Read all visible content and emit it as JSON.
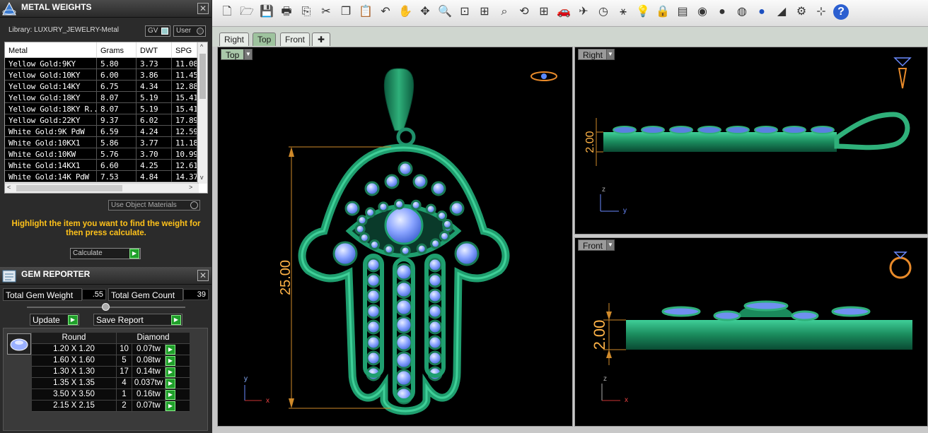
{
  "metal_panel": {
    "title": "METAL WEIGHTS",
    "library": "Library: LUXURY_JEWELRY-Metal",
    "toggle_gv": "GV",
    "toggle_user": "User",
    "columns": [
      "Metal",
      "Grams",
      "DWT",
      "SPG"
    ],
    "rows": [
      {
        "metal": "Yellow Gold:9KY",
        "grams": "5.80",
        "dwt": "3.73",
        "spg": "11.08"
      },
      {
        "metal": "Yellow Gold:10KY",
        "grams": "6.00",
        "dwt": "3.86",
        "spg": "11.45"
      },
      {
        "metal": "Yellow Gold:14KY",
        "grams": "6.75",
        "dwt": "4.34",
        "spg": "12.88"
      },
      {
        "metal": "Yellow Gold:18KY",
        "grams": "8.07",
        "dwt": "5.19",
        "spg": "15.41"
      },
      {
        "metal": "Yellow Gold:18KY R...",
        "grams": "8.07",
        "dwt": "5.19",
        "spg": "15.41"
      },
      {
        "metal": "Yellow Gold:22KY",
        "grams": "9.37",
        "dwt": "6.02",
        "spg": "17.89"
      },
      {
        "metal": "White Gold:9K PdW",
        "grams": "6.59",
        "dwt": "4.24",
        "spg": "12.59"
      },
      {
        "metal": "White Gold:10KX1",
        "grams": "5.86",
        "dwt": "3.77",
        "spg": "11.18"
      },
      {
        "metal": "White Gold:10KW",
        "grams": "5.76",
        "dwt": "3.70",
        "spg": "10.99"
      },
      {
        "metal": "White Gold:14KX1",
        "grams": "6.60",
        "dwt": "4.25",
        "spg": "12.61"
      },
      {
        "metal": "White Gold:14K PdW",
        "grams": "7.53",
        "dwt": "4.84",
        "spg": "14.37"
      }
    ],
    "use_object_materials": "Use Object Materials",
    "hint": "Highlight the item you want to find the weight for then press calculate.",
    "calculate": "Calculate"
  },
  "gem_panel": {
    "title": "GEM REPORTER",
    "total_weight_label": "Total Gem Weight",
    "total_weight_value": ".55",
    "total_count_label": "Total Gem Count",
    "total_count_value": "39",
    "update": "Update",
    "save_report": "Save Report",
    "shape": "Round",
    "stone": "Diamond",
    "rows": [
      {
        "size": "1.20 X 1.20",
        "count": "10",
        "tw": "0.07tw"
      },
      {
        "size": "1.60 X 1.60",
        "count": "5",
        "tw": "0.08tw"
      },
      {
        "size": "1.30 X 1.30",
        "count": "17",
        "tw": "0.14tw"
      },
      {
        "size": "1.35 X 1.35",
        "count": "4",
        "tw": "0.037tw"
      },
      {
        "size": "3.50 X 3.50",
        "count": "1",
        "tw": "0.16tw"
      },
      {
        "size": "2.15 X 2.15",
        "count": "2",
        "tw": "0.07tw"
      }
    ]
  },
  "tabs": [
    "Right",
    "Top",
    "Front"
  ],
  "viewports": {
    "top": {
      "label": "Top",
      "dimension": "25.00",
      "axis_y": "y",
      "axis_x": "x"
    },
    "right": {
      "label": "Right",
      "dimension": "2.00",
      "axis_z": "z",
      "axis_y": "y"
    },
    "front": {
      "label": "Front",
      "dimension": "2.00",
      "axis_z": "z",
      "axis_x": "x"
    }
  },
  "colors": {
    "accent_green": "#1f9f2a",
    "model_green": "#1f8f6a",
    "gem_blue": "#7f9fff",
    "dim_orange": "#ffb347",
    "hint_yellow": "#ffc21a"
  }
}
